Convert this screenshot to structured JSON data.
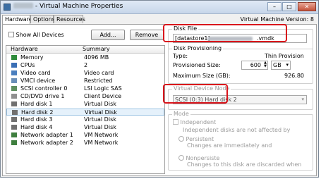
{
  "window": {
    "title_prefix": "",
    "title": "- Virtual Machine Properties",
    "minimize": "–",
    "maximize": "□",
    "close": "✕"
  },
  "tabs": [
    {
      "label": "Hardware"
    },
    {
      "label": "Options"
    },
    {
      "label": "Resources"
    }
  ],
  "vm_version": "Virtual Machine Version: 8",
  "controls": {
    "show_all_devices": "Show All Devices",
    "add_button": "Add...",
    "remove_button": "Remove"
  },
  "hardware_table": {
    "headers": {
      "name": "Hardware",
      "summary": "Summary"
    },
    "rows": [
      {
        "name": "Memory",
        "summary": "4096 MB",
        "icon": "memory-icon",
        "color": "#2e8b3a"
      },
      {
        "name": "CPUs",
        "summary": "2",
        "icon": "cpu-icon",
        "color": "#3a6fb5"
      },
      {
        "name": "Video card",
        "summary": "Video card",
        "icon": "video-card-icon",
        "color": "#4a7fbf"
      },
      {
        "name": "VMCI device",
        "summary": "Restricted",
        "icon": "vmci-device-icon",
        "color": "#6a8fb8"
      },
      {
        "name": "SCSI controller 0",
        "summary": "LSI Logic SAS",
        "icon": "scsi-controller-icon",
        "color": "#5f8f5f"
      },
      {
        "name": "CD/DVD drive 1",
        "summary": "Client Device",
        "icon": "cd-dvd-icon",
        "color": "#909090"
      },
      {
        "name": "Hard disk 1",
        "summary": "Virtual Disk",
        "icon": "hard-disk-icon",
        "color": "#707070"
      },
      {
        "name": "Hard disk 2",
        "summary": "Virtual Disk",
        "icon": "hard-disk-icon",
        "color": "#707070",
        "selected": true
      },
      {
        "name": "Hard disk 3",
        "summary": "Virtual Disk",
        "icon": "hard-disk-icon",
        "color": "#707070"
      },
      {
        "name": "Hard disk 4",
        "summary": "Virtual Disk",
        "icon": "hard-disk-icon",
        "color": "#707070"
      },
      {
        "name": "Network adapter 1",
        "summary": "VM Network",
        "icon": "network-adapter-icon",
        "color": "#3f7f3f"
      },
      {
        "name": "Network adapter 2",
        "summary": "VM Network",
        "icon": "network-adapter-icon",
        "color": "#3f7f3f"
      }
    ]
  },
  "disk_file": {
    "legend": "Disk File",
    "path_prefix": "[datastore1]",
    "path_suffix": ".vmdk"
  },
  "disk_provisioning": {
    "legend": "Disk Provisioning",
    "type_label": "Type:",
    "type_value": "Thin Provision",
    "size_label": "Provisioned Size:",
    "size_value": "600",
    "size_unit": "GB",
    "max_label": "Maximum Size (GB):",
    "max_value": "926.80"
  },
  "virtual_device_node": {
    "legend": "Virtual Device Node",
    "value": "SCSI (0:3) Hard disk 2"
  },
  "mode": {
    "legend": "Mode",
    "independent_label": "Independent",
    "independent_desc": "Independent disks are not affected by",
    "persistent_label": "Persistent",
    "persistent_desc": "Changes are immediately and",
    "nonpersistent_label": "Nonpersiste",
    "nonpersistent_desc": "Changes to this disk are discarded when"
  },
  "colors": {
    "highlight": "#d9141b",
    "selection": "#e5f1fb"
  }
}
